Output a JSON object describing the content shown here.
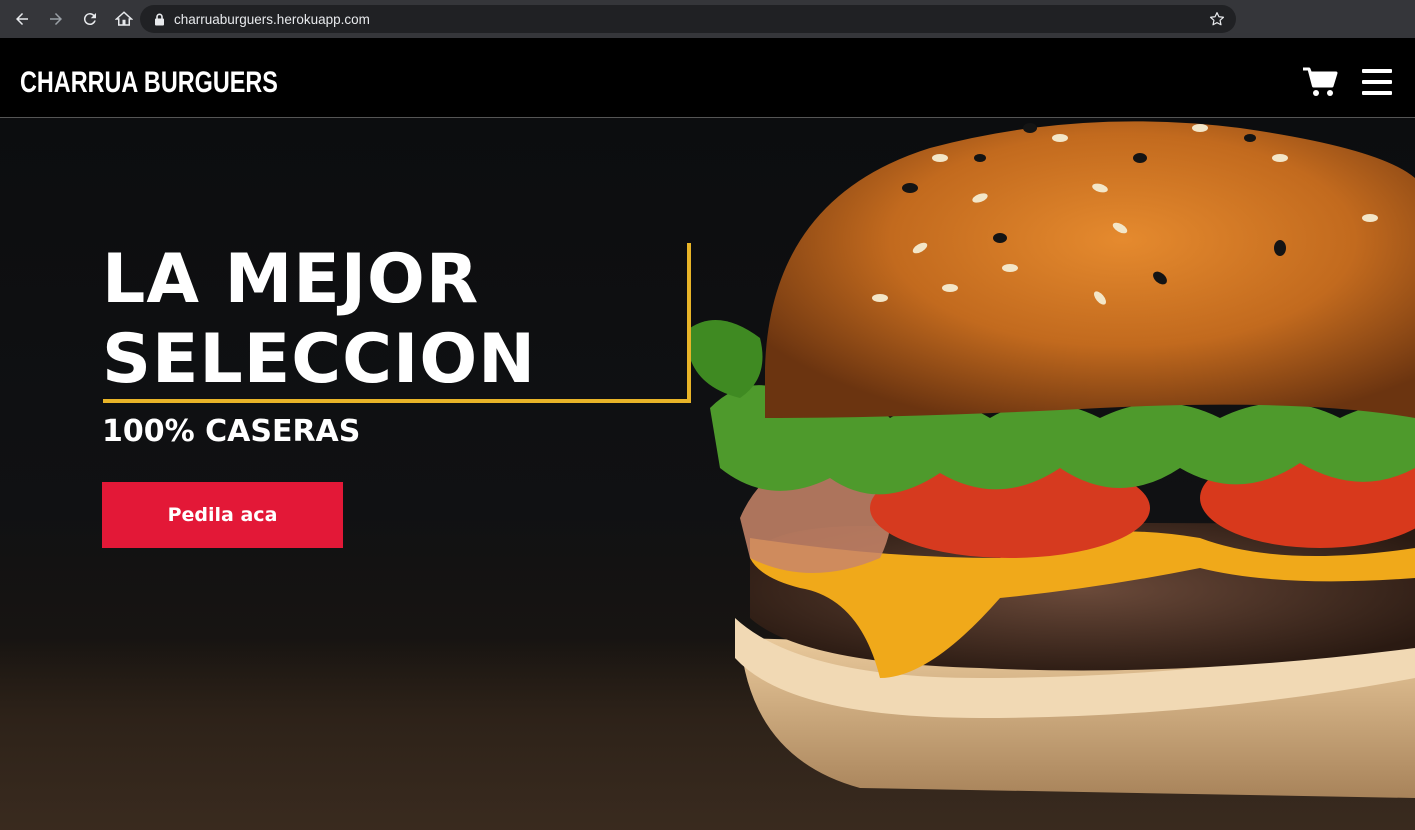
{
  "browser": {
    "url": "charruaburguers.herokuapp.com",
    "icons": [
      "back-icon",
      "forward-icon",
      "reload-icon",
      "home-icon",
      "lock-icon",
      "star-icon"
    ]
  },
  "header": {
    "brand": "CHARRUA BURGUERS",
    "icons": [
      "cart-icon",
      "hamburger-menu-icon"
    ]
  },
  "hero": {
    "headline_line1": "LA MEJOR",
    "headline_line2": "SELECCION",
    "subheadline": "100% CASERAS",
    "cta_label": "Pedila aca"
  },
  "colors": {
    "accent_yellow": "#e8b428",
    "cta_red": "#e31837",
    "header_bg": "#000000",
    "browser_chrome": "#35363a"
  }
}
